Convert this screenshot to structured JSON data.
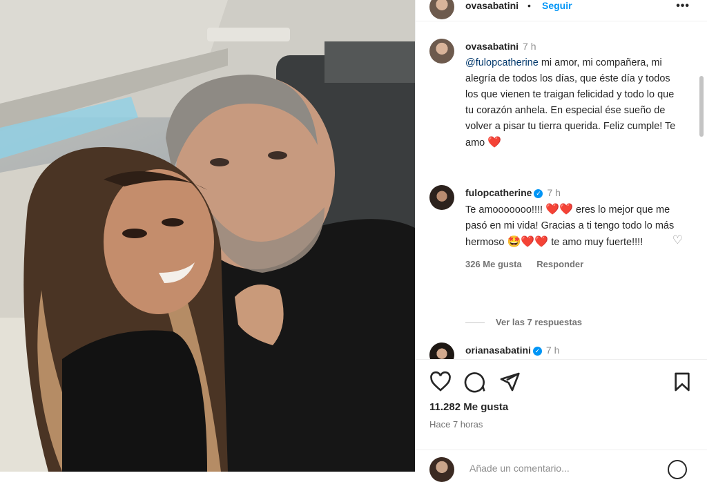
{
  "post": {
    "author": "ovasabatini",
    "separator": "•",
    "follow_label": "Seguir",
    "more_label": "•••"
  },
  "comments": [
    {
      "user": "ovasabatini",
      "time": "7 h",
      "mention": "@fulopcatherine",
      "text": " mi amor, mi compañera, mi alegría de todos los días, que éste día y todos los que vienen te traigan felicidad y todo lo que tu corazón anhela. En especial ése sueño de volver a pisar tu tierra querida. Feliz cumple! Te amo ",
      "emoji": "❤️"
    },
    {
      "user": "fulopcatherine",
      "verified": "✓",
      "time": "7 h",
      "text_a": "Te amooooooo!!!! ",
      "emoji_a": "❤️❤️",
      "text_b": " eres lo mejor que me pasó en mi vida! Gracias a ti tengo todo lo más hermoso ",
      "emoji_b": "🤩❤️❤️",
      "text_c": " te amo muy fuerte!!!!",
      "likes": "326 Me gusta",
      "reply": "Responder",
      "view_replies": "Ver las 7 respuestas"
    },
    {
      "user": "orianasabatini",
      "verified": "✓",
      "time": "7 h"
    }
  ],
  "actions": {
    "like_count": "11.282 Me gusta",
    "posted": "Hace 7 horas",
    "add_comment_placeholder": "Añade un comentario..."
  },
  "icons": [
    "heart-icon",
    "comment-icon",
    "share-icon",
    "bookmark-icon",
    "emoji-icon"
  ],
  "colors": {
    "accent": "#0095f6",
    "text": "#262626",
    "muted": "#737373",
    "heart": "#ed1c24"
  }
}
